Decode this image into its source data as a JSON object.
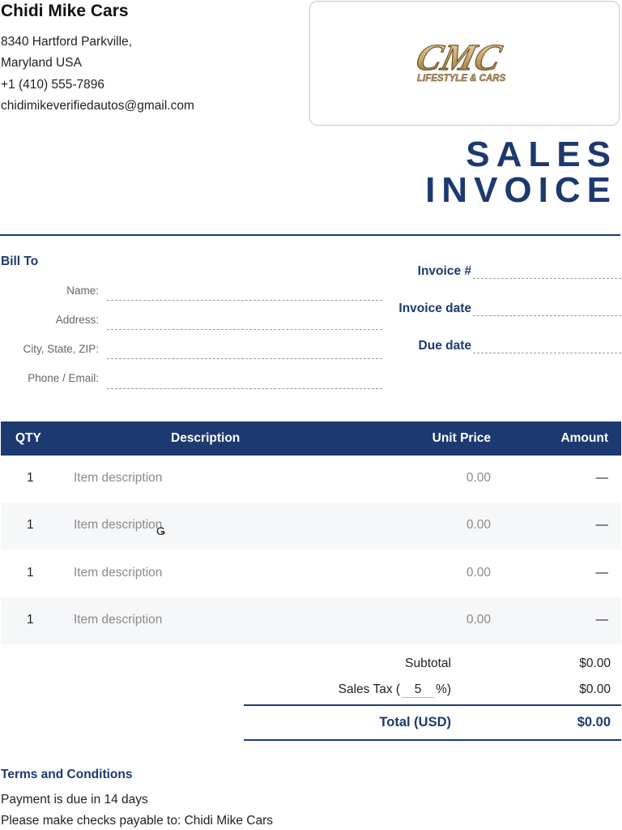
{
  "company": {
    "name": "Chidi Mike Cars",
    "address_line1": "8340 Hartford Parkville,",
    "address_line2": "Maryland USA",
    "phone": "+1 (410) 555-7896",
    "email": "chidimikeverifiedautos@gmail.com"
  },
  "logo": {
    "letters": "CMC",
    "tagline": "LIFESTYLE & CARS"
  },
  "title": {
    "line1": "SALES",
    "line2": "INVOICE"
  },
  "bill_to": {
    "heading": "Bill To",
    "name_label": "Name:",
    "address_label": "Address:",
    "city_label": "City, State, ZIP:",
    "contact_label": "Phone / Email:"
  },
  "invoice_meta": {
    "number_label": "Invoice #",
    "date_label": "Invoice date",
    "due_label": "Due date"
  },
  "table": {
    "headers": {
      "qty": "QTY",
      "description": "Description",
      "unit_price": "Unit Price",
      "amount": "Amount"
    },
    "rows": [
      {
        "qty": "1",
        "description": "Item description",
        "unit_price": "0.00",
        "amount": "—"
      },
      {
        "qty": "1",
        "description": "Item description",
        "unit_price": "0.00",
        "amount": "—"
      },
      {
        "qty": "1",
        "description": "Item description",
        "unit_price": "0.00",
        "amount": "—"
      },
      {
        "qty": "1",
        "description": "Item description",
        "unit_price": "0.00",
        "amount": "—"
      }
    ]
  },
  "totals": {
    "subtotal_label": "Subtotal",
    "subtotal_value": "$0.00",
    "tax_prefix": "Sales Tax (",
    "tax_rate": "5",
    "tax_suffix": "%)",
    "tax_value": "$0.00",
    "total_label": "Total (USD)",
    "total_value": "$0.00"
  },
  "terms": {
    "heading": "Terms and Conditions",
    "line1": "Payment is due in 14 days",
    "line2": "Please make checks payable to: Chidi Mike Cars"
  },
  "colors": {
    "brand_navy": "#1c3a70",
    "logo_gold": "#c9a86a"
  },
  "icons": {
    "cursor": "grab-cursor-icon"
  }
}
